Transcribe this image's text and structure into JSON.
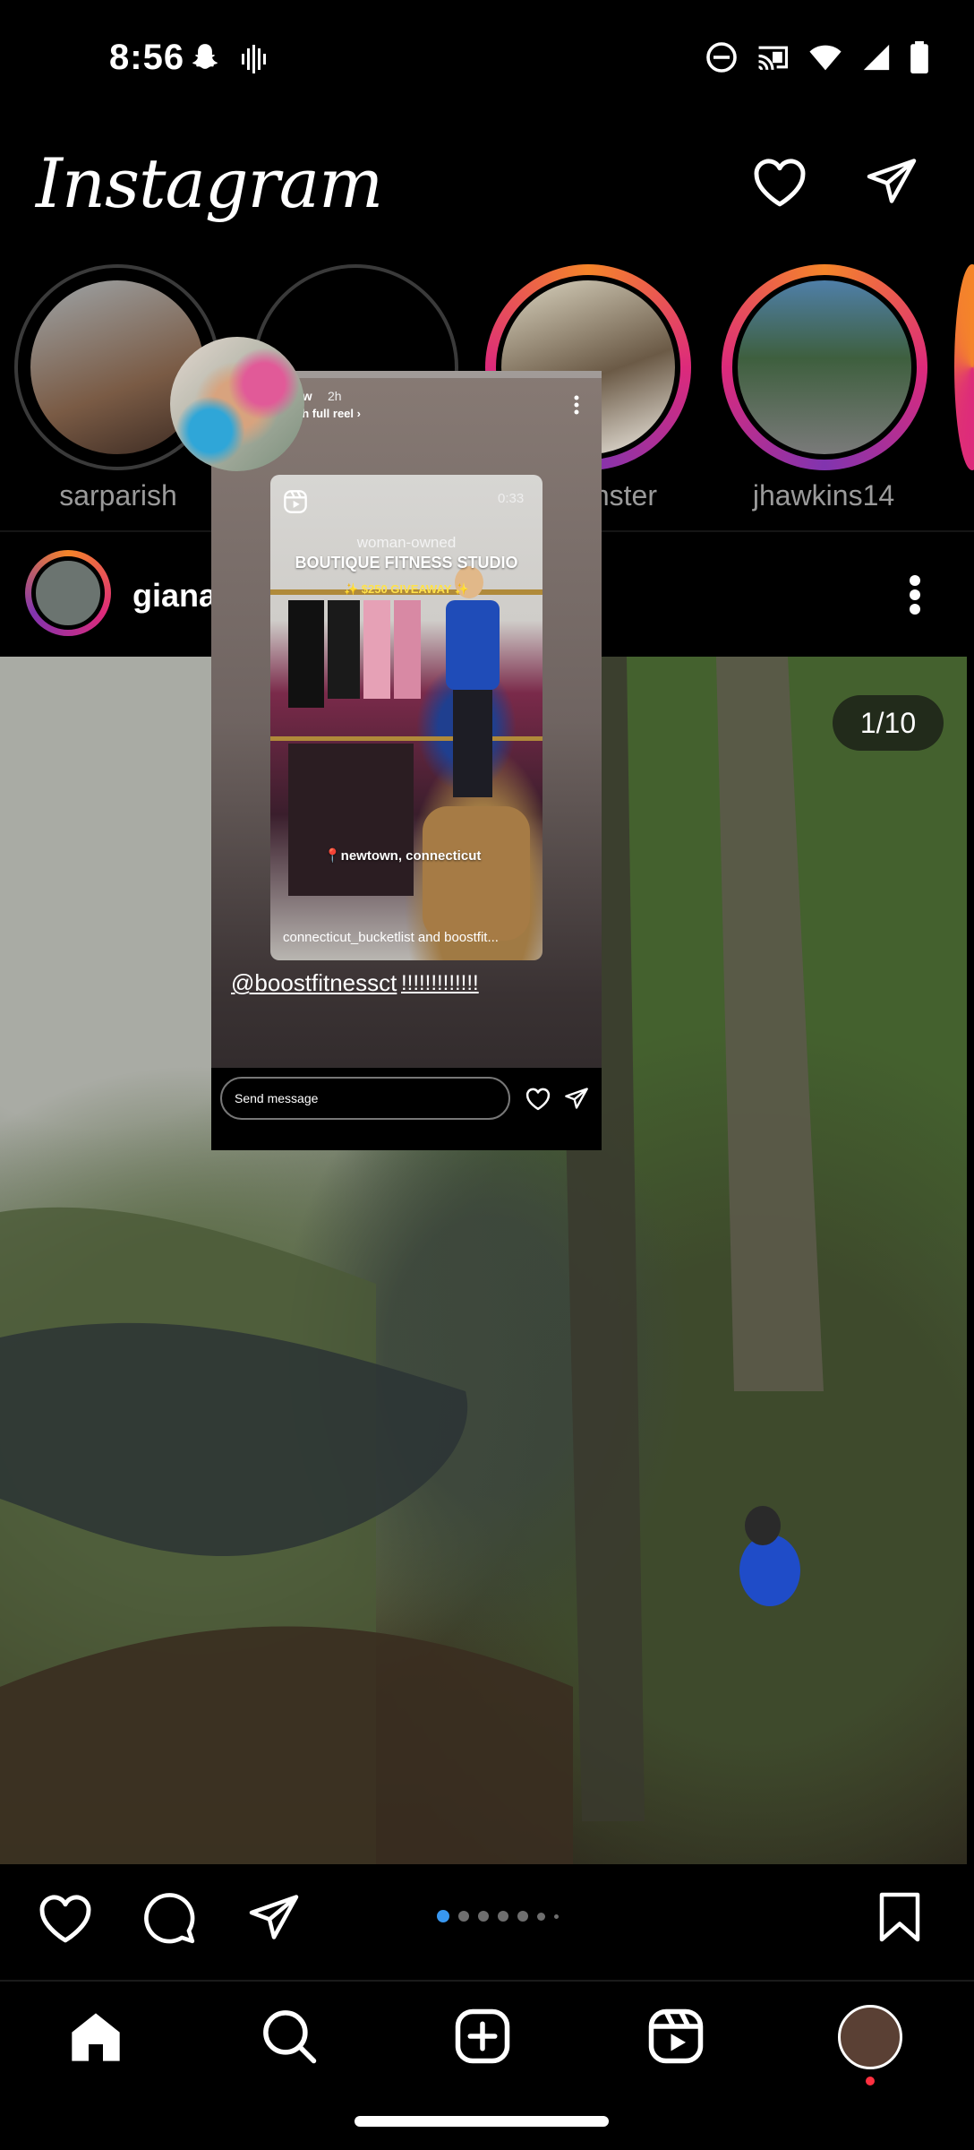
{
  "status_bar": {
    "time": "8:56",
    "icons": [
      "snapchat-icon",
      "voicemail-icon",
      "do-not-disturb-icon",
      "cast-icon",
      "wifi-icon",
      "signal-icon",
      "battery-icon"
    ]
  },
  "header": {
    "logo": "Instagram",
    "icons": [
      "heart-icon",
      "direct-message-icon"
    ]
  },
  "stories": [
    {
      "name": "sarparish",
      "ring": "seen"
    },
    {
      "name": "",
      "ring": "seen"
    },
    {
      "name": "nster",
      "ring": "new"
    },
    {
      "name": "jhawkins14",
      "ring": "new"
    }
  ],
  "post": {
    "username": "giana",
    "counter": "1/10",
    "carousel_active_index": 0
  },
  "story_preview": {
    "username": "_w",
    "time": "2h",
    "subtitle": "ch full reel",
    "reel": {
      "duration": "0:33",
      "line1": "woman-owned",
      "line2": "BOUTIQUE FITNESS STUDIO",
      "line3": "✨ $250 GIVEAWAY ✨",
      "location": "📍newtown, connecticut",
      "caption": "connecticut_bucketlist and boostfit..."
    },
    "mention": "@boostfitnessct",
    "exclamations": "!!!!!!!!!!!!!",
    "send_placeholder": "Send message"
  },
  "bottom_nav": [
    "home-icon",
    "search-icon",
    "create-icon",
    "reels-icon",
    "profile-avatar"
  ],
  "colors": {
    "background": "#000000",
    "story_ring_gradient": [
      "#f58529",
      "#dd2a7b",
      "#8134af"
    ],
    "active_dot": "#3897f0",
    "notification_dot": "#ff3040"
  }
}
